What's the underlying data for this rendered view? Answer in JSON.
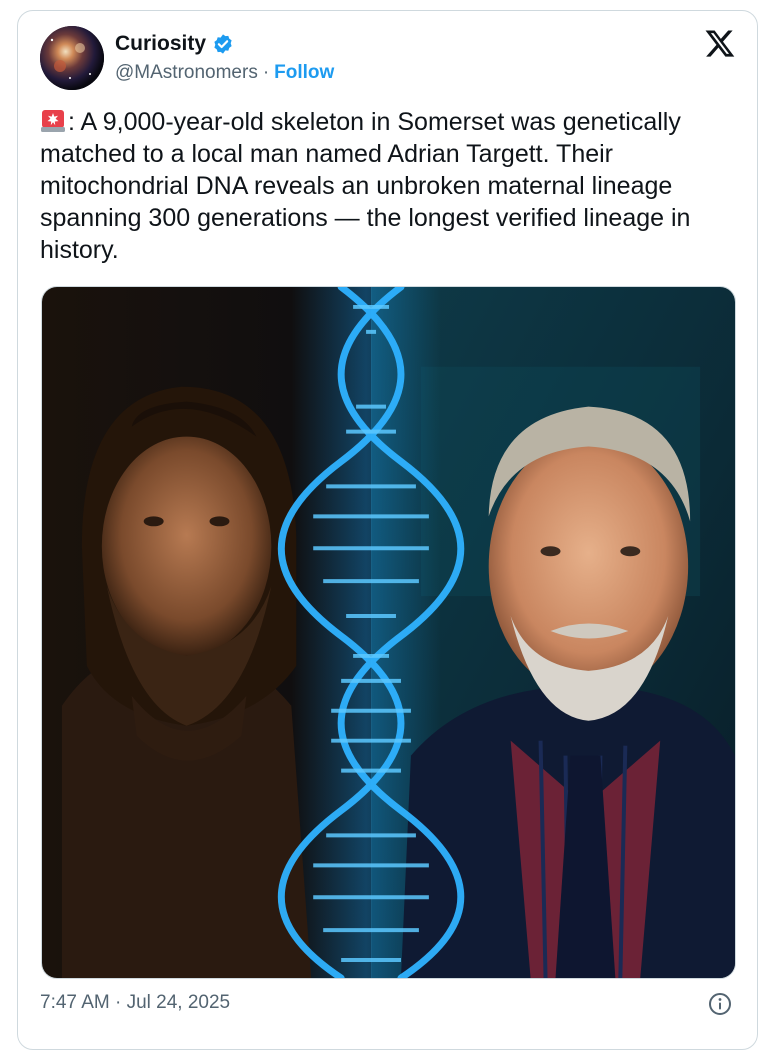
{
  "author": {
    "name": "Curiosity",
    "handle": "@MAstronomers",
    "separator": "·",
    "follow_label": "Follow",
    "verified_icon": "verified-badge-icon",
    "avatar_icon": "nebula-avatar"
  },
  "logo_icon": "x-logo-icon",
  "tweet": {
    "emoji_icon": "rotating-light-icon",
    "text": ": A 9,000-year-old skeleton in Somerset was genetically matched to a local man named Adrian Targett. Their mitochondrial DNA reveals an unbroken maternal lineage spanning 300 generations — the longest verified lineage in history."
  },
  "media": {
    "icon": "dna-double-helix-image"
  },
  "footer": {
    "timestamp": "7:47 AM · Jul 24, 2025",
    "info_icon": "info-circle-icon"
  },
  "colors": {
    "accent": "#1d9bf0",
    "text": "#0f1419",
    "secondary": "#536471",
    "border": "#cfd9de"
  }
}
